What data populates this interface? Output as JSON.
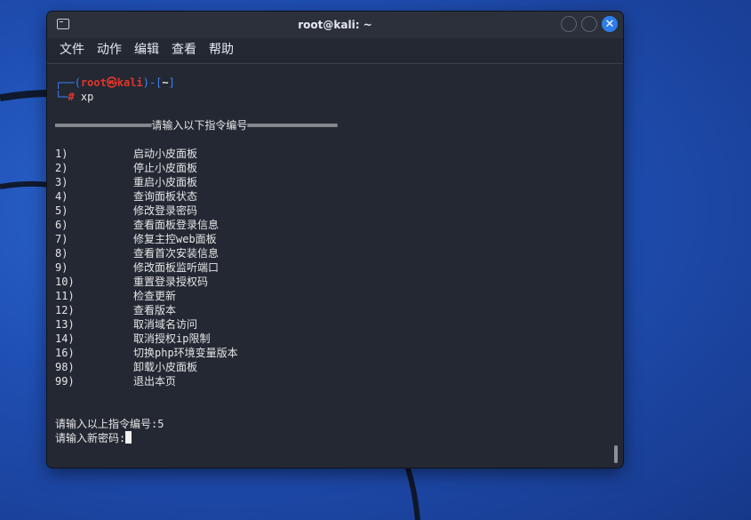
{
  "window": {
    "title": "root@kali: ~",
    "close_glyph": "✕"
  },
  "menubar": [
    {
      "label": "文件"
    },
    {
      "label": "动作"
    },
    {
      "label": "编辑"
    },
    {
      "label": "查看"
    },
    {
      "label": "帮助"
    }
  ],
  "terminal": {
    "prompt_open": "┌──(",
    "prompt_user": "root㉿kali",
    "prompt_mid": ")-[",
    "prompt_dir": "~",
    "prompt_close": "]",
    "prompt2_prefix": "└─",
    "prompt2_hash": "#",
    "command": " xp",
    "banner": "═══════════════请输入以下指令编号══════════════",
    "options": [
      {
        "num": "1)",
        "text": "启动小皮面板"
      },
      {
        "num": "2)",
        "text": "停止小皮面板"
      },
      {
        "num": "3)",
        "text": "重启小皮面板"
      },
      {
        "num": "4)",
        "text": "查询面板状态"
      },
      {
        "num": "5)",
        "text": "修改登录密码"
      },
      {
        "num": "6)",
        "text": "查看面板登录信息"
      },
      {
        "num": "7)",
        "text": "修复主控web面板"
      },
      {
        "num": "8)",
        "text": "查看首次安装信息"
      },
      {
        "num": "9)",
        "text": "修改面板监听端口"
      },
      {
        "num": "10)",
        "text": "重置登录授权码"
      },
      {
        "num": "11)",
        "text": "检查更新"
      },
      {
        "num": "12)",
        "text": "查看版本"
      },
      {
        "num": "13)",
        "text": "取消域名访问"
      },
      {
        "num": "14)",
        "text": "取消授权ip限制"
      },
      {
        "num": "16)",
        "text": "切换php环境变量版本"
      },
      {
        "num": "98)",
        "text": "卸载小皮面板"
      },
      {
        "num": "99)",
        "text": "退出本页"
      }
    ],
    "input_line": "请输入以上指令编号:5",
    "password_line": "请输入新密码:"
  },
  "colors": {
    "prompt_frame": "#3b82f6",
    "prompt_user": "#e0362b",
    "close_button": "#2e7de9"
  }
}
